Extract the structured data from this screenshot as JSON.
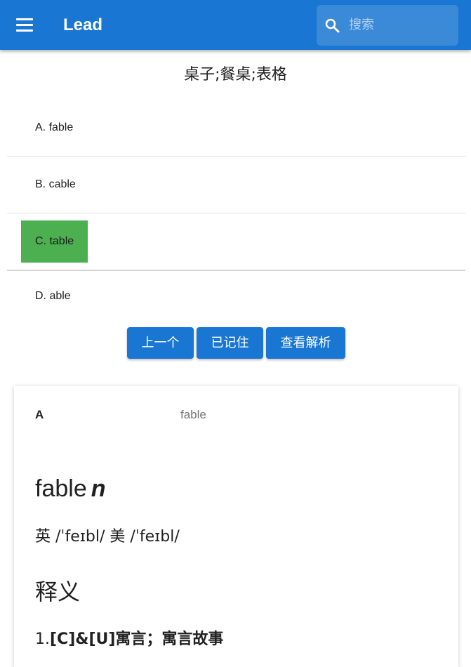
{
  "appbar": {
    "title": "Lead",
    "search_placeholder": "搜索",
    "menu_icon": "menu-icon",
    "search_icon": "search-icon",
    "color": "#1976d2"
  },
  "question": "桌子;餐桌;表格",
  "options": [
    {
      "label": "A. fable",
      "correct": false
    },
    {
      "label": "B. cable",
      "correct": false
    },
    {
      "label": "C. table",
      "correct": true
    },
    {
      "label": "D. able",
      "correct": false
    }
  ],
  "buttons": {
    "prev": "上一个",
    "remembered": "已记住",
    "analysis": "查看解析"
  },
  "detail": {
    "letter": "A",
    "word": "fable",
    "headword": "fable",
    "pos": "n",
    "phonetic": "英 /ˈfeɪbl/ 美 /ˈfeɪbl/",
    "section_title": "释义",
    "definition_num": "1.",
    "definition_text": "[C]&[U]寓言；寓言故事"
  },
  "colors": {
    "correct": "#4caf50",
    "button": "#1976d2"
  }
}
